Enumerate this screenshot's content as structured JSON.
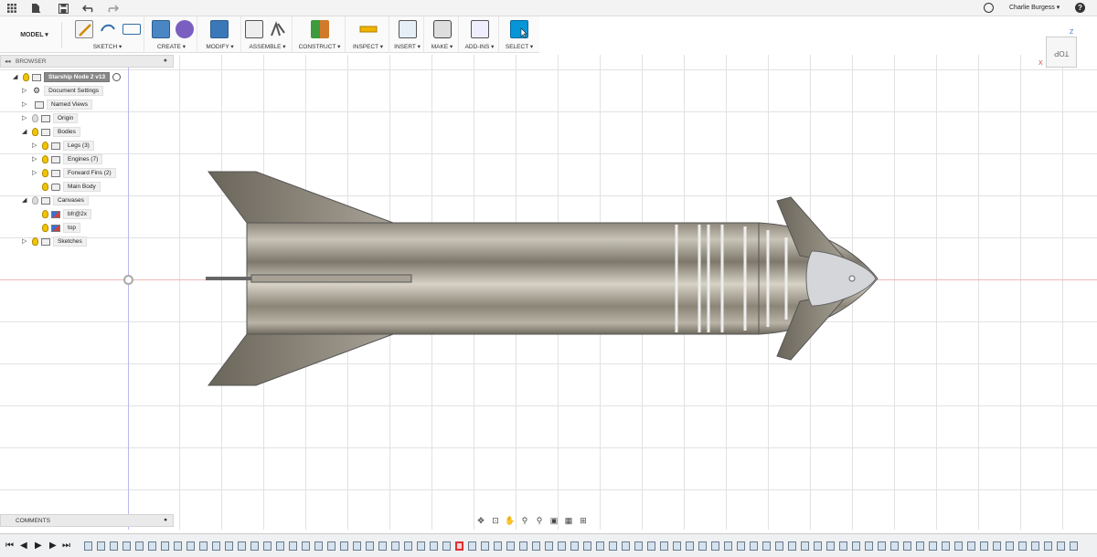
{
  "topbar": {
    "user_name": "Charlie Burgess ▾",
    "help_icon": "?"
  },
  "toolbar": {
    "workspace": "MODEL ▾",
    "groups": {
      "sketch": "SKETCH ▾",
      "create": "CREATE ▾",
      "modify": "MODIFY ▾",
      "assemble": "ASSEMBLE ▾",
      "construct": "CONSTRUCT ▾",
      "inspect": "INSPECT ▾",
      "insert": "INSERT ▾",
      "make": "MAKE ▾",
      "addins": "ADD-INS ▾",
      "select": "SELECT ▾"
    }
  },
  "browser": {
    "title": "BROWSER",
    "root": "Starship Node 2 v13",
    "items": [
      {
        "label": "Document Settings"
      },
      {
        "label": "Named Views"
      },
      {
        "label": "Origin"
      },
      {
        "label": "Bodies"
      },
      {
        "label": "Legs (3)"
      },
      {
        "label": "Engines (7)"
      },
      {
        "label": "Forward Fins (2)"
      },
      {
        "label": "Main Body"
      },
      {
        "label": "Canvases"
      },
      {
        "label": "bfr@2x"
      },
      {
        "label": "top"
      },
      {
        "label": "Sketches"
      }
    ]
  },
  "comments": {
    "title": "COMMENTS"
  },
  "viewcube": {
    "face": "TOP",
    "axis_x": "X",
    "axis_z": "Z"
  },
  "colors": {
    "accent": "#0696d7",
    "body_metal": "#a7a195",
    "fin": "#6f6a5e",
    "selected_timeline": "#e03030"
  }
}
